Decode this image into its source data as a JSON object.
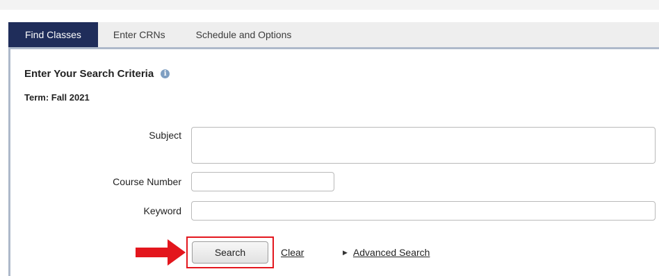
{
  "tabs": [
    {
      "label": "Find Classes",
      "active": true
    },
    {
      "label": "Enter CRNs",
      "active": false
    },
    {
      "label": "Schedule and Options",
      "active": false
    }
  ],
  "panel": {
    "title": "Enter Your Search Criteria",
    "info_icon": "info-icon",
    "term": "Term: Fall 2021"
  },
  "form": {
    "subject_label": "Subject",
    "subject_value": "",
    "course_number_label": "Course Number",
    "course_number_value": "",
    "keyword_label": "Keyword",
    "keyword_value": ""
  },
  "actions": {
    "search_label": "Search",
    "clear_label": "Clear",
    "advanced_search_label": "Advanced Search"
  },
  "colors": {
    "active_tab": "#1f2d5a",
    "panel_border": "#aeb9ca",
    "annotation_red": "#e3161d"
  }
}
